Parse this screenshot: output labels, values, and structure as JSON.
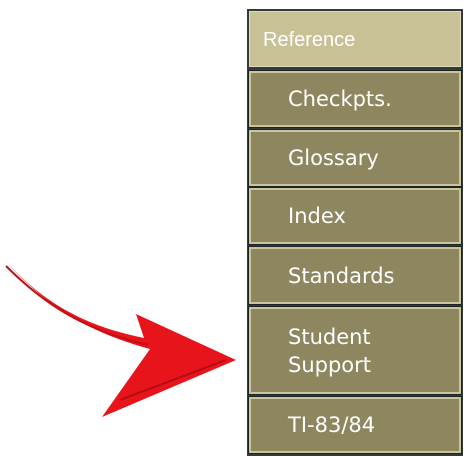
{
  "sidebar": {
    "header": "Reference",
    "items": [
      {
        "label": "Checkpts."
      },
      {
        "label": "Glossary"
      },
      {
        "label": "Index"
      },
      {
        "label": "Standards"
      },
      {
        "label": "Student Support"
      },
      {
        "label": "TI-83/84"
      }
    ]
  },
  "colors": {
    "header_bg": "#c8c195",
    "item_bg": "#8d865e",
    "item_border": "#c9c59d",
    "panel_bg": "#323a3a",
    "arrow": "#e8141c"
  },
  "annotation": {
    "icon": "red-curved-arrow-icon"
  }
}
